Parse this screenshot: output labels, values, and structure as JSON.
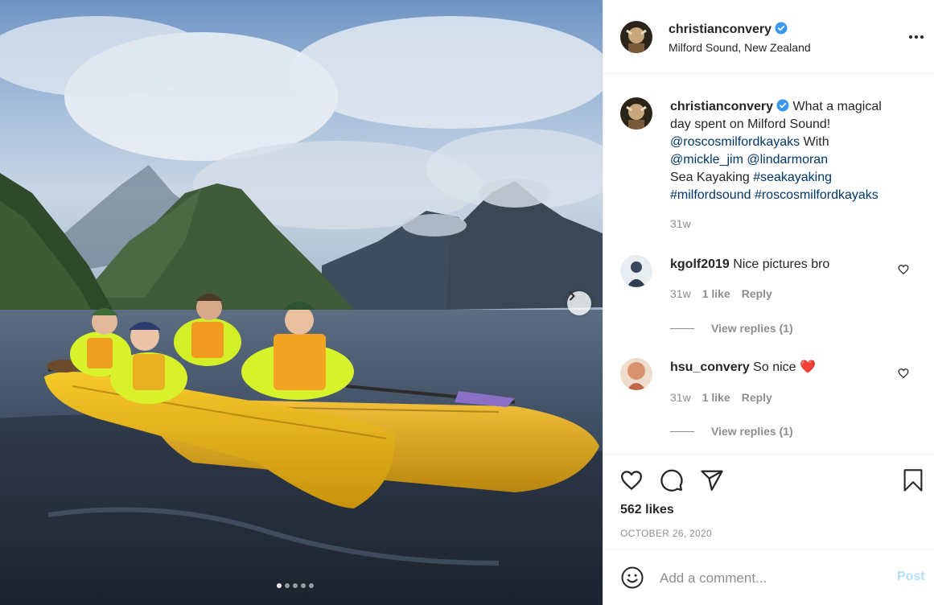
{
  "post": {
    "username": "christianconvery",
    "location": "Milford Sound, New Zealand",
    "verified": true
  },
  "caption": {
    "username": "christianconvery",
    "text_1": "What a magical",
    "text_2": "day spent on Milford Sound!",
    "mention_1": "@roscosmilfordkayaks",
    "text_3": "With",
    "mention_2": "@mickle_jim",
    "mention_3": "@lindarmoran",
    "text_4": "Sea Kayaking",
    "tag_1": "#seakayaking",
    "tag_2": "#milfordsound",
    "tag_3": "#roscosmilfordkayaks",
    "time": "31w"
  },
  "comments": [
    {
      "username": "kgolf2019",
      "text": "Nice pictures bro",
      "time": "31w",
      "likes": "1 like",
      "reply": "Reply",
      "view_replies": "View replies (1)"
    },
    {
      "username": "hsu_convery",
      "text": "So nice",
      "emoji": "❤️",
      "time": "31w",
      "likes": "1 like",
      "reply": "Reply",
      "view_replies": "View replies (1)"
    }
  ],
  "stats": {
    "likes": "562 likes",
    "date": "OCTOBER 26, 2020"
  },
  "composer": {
    "placeholder": "Add a comment...",
    "post_label": "Post"
  },
  "carousel": {
    "total": 5,
    "current": 1
  },
  "icons": {
    "like": "heart-outline-icon",
    "comment": "speech-bubble-icon",
    "share": "paper-plane-icon",
    "save": "bookmark-icon",
    "emoji": "smiley-icon",
    "more": "ellipsis-icon",
    "next": "chevron-right-icon",
    "verified": "verified-badge-icon"
  },
  "colors": {
    "verified": "#3897f0",
    "link": "#00376b",
    "muted": "#8e8e8e",
    "post_disabled": "#b2dffc"
  }
}
